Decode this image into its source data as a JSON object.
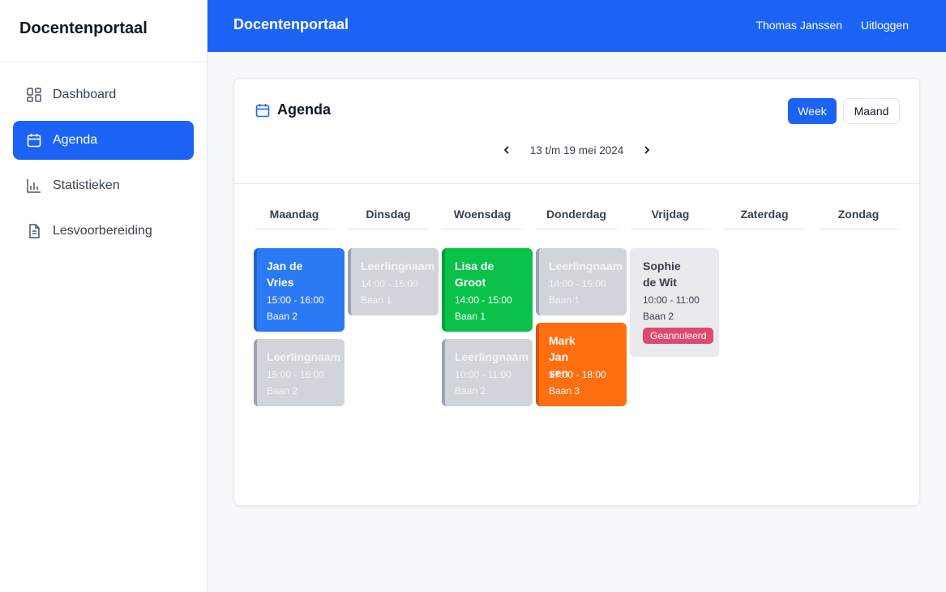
{
  "app": {
    "brand": "Docentenportaal"
  },
  "sidebar": {
    "items": [
      {
        "label": "Dashboard",
        "icon": "dashboard-icon",
        "active": false
      },
      {
        "label": "Agenda",
        "icon": "calendar-icon",
        "active": true
      },
      {
        "label": "Statistieken",
        "icon": "bar-chart-icon",
        "active": false
      },
      {
        "label": "Lesvoorbereiding",
        "icon": "document-icon",
        "active": false
      }
    ]
  },
  "header": {
    "title": "Docentenportaal",
    "user": "Thomas Janssen",
    "logout": "Uitloggen"
  },
  "agenda": {
    "title": "Agenda",
    "view_week": "Week",
    "view_month": "Maand",
    "active_view": "Week",
    "week_label": "13 t/m 19 mei 2024",
    "days": [
      "Maandag",
      "Dinsdag",
      "Woensdag",
      "Donderdag",
      "Vrijdag",
      "Zaterdag",
      "Zondag"
    ],
    "events": [
      {
        "day": "Maandag",
        "name": "Jan de\nVries",
        "time": "15:00 - 16:00",
        "lane": "Baan 2",
        "status": "booked"
      },
      {
        "day": "Maandag",
        "name": "Leerlingnaam",
        "time": "15:00 - 16:00",
        "lane": "Baan 2",
        "status": "available"
      },
      {
        "day": "Dinsdag",
        "name": "Leerlingnaam",
        "time": "14:00 - 15:00",
        "lane": "Baan 1",
        "status": "available"
      },
      {
        "day": "Woensdag",
        "name": "Lisa de\nGroot",
        "time": "14:00 - 15:00",
        "lane": "Baan 1",
        "status": "booked"
      },
      {
        "day": "Woensdag",
        "name": "Leerlingnaam",
        "time": "10:00 - 11:00",
        "lane": "Baan 2",
        "status": "available"
      },
      {
        "day": "Donderdag",
        "name": "Leerlingnaam",
        "time": "14:00 - 15:00",
        "lane": "Baan 1",
        "status": "available"
      },
      {
        "day": "Donderdag",
        "name": "Mark\nJan\nsen",
        "time": "17:00 - 18:00",
        "lane": "Baan 3",
        "status": "booked"
      },
      {
        "day": "Vrijdag",
        "name": "Sophie\nde Wit",
        "time": "10:00 - 11:00",
        "lane": "Baan 2",
        "status": "cancelled",
        "badge": "Geannuleerd"
      }
    ]
  },
  "colors": {
    "primary": "#1a63f5",
    "event_blue": "#2b79f4",
    "event_green": "#0ac24a",
    "event_orange": "#ff6e0f",
    "event_gray": "#d1d5db",
    "event_cancelled": "#e9eaee",
    "badge_cancelled": "#e0496f"
  }
}
